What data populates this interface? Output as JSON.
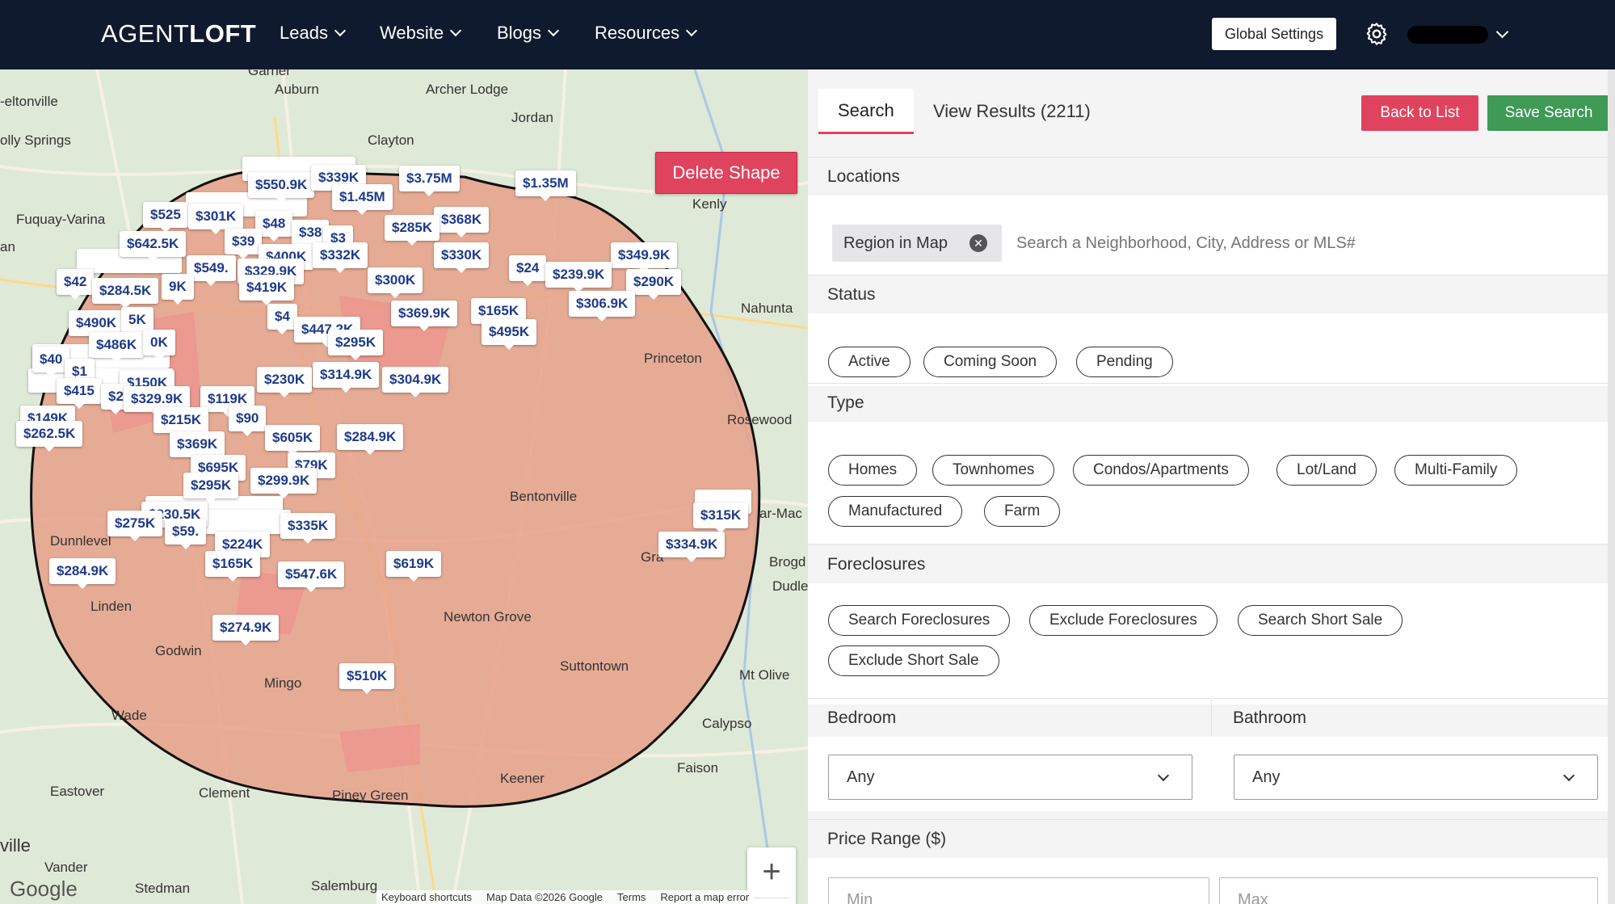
{
  "nav": {
    "logo_light": "AGENT",
    "logo_bold": "LOFT",
    "items": [
      {
        "label": "Leads"
      },
      {
        "label": "Website"
      },
      {
        "label": "Blogs"
      },
      {
        "label": "Resources"
      }
    ],
    "global_settings": "Global Settings",
    "icons": {
      "settings": "gear-icon",
      "user_menu": "chevron-down-icon"
    }
  },
  "map": {
    "delete_shape": "Delete Shape",
    "zoom_in": "+",
    "zoom_out": "−",
    "google": "Google",
    "footer": {
      "shortcuts": "Keyboard shortcuts",
      "map_data": "Map Data ©2026 Google",
      "terms": "Terms",
      "report": "Report a map error"
    },
    "places": [
      "Auburn",
      "Archer Lodge",
      "Jordan",
      "Clayton",
      "Fuquay-Varina",
      "Kenly",
      "Nahunta",
      "Princeton",
      "Rosewood",
      "Bentonville",
      "Dunnlevel",
      "Linden",
      "Godwin",
      "Mingo",
      "Newton Grove",
      "Suttontown",
      "Mt Olive",
      "Wade",
      "Calypso",
      "Faison",
      "Eastover",
      "Clement",
      "Piney Green",
      "Keener",
      "Vander",
      "Stedman",
      "Salemburg",
      "-eltonville",
      "olly Springs",
      "Brogd",
      "Dudle",
      "ville",
      "an",
      "Garner",
      "Gra",
      "ar-Mac"
    ],
    "pins": [
      "$550.9K",
      "$339K",
      "$3.75M",
      "$1.35M",
      "$1.45M",
      "$525",
      "$301K",
      "$48",
      "$368K",
      "$642.5K",
      "$39",
      "$38",
      "$3",
      "$285K",
      "$400K",
      "$332K",
      "$330K",
      "$349.9K",
      "$549.",
      "$329.9K",
      "$300K",
      "$24",
      "$239.9K",
      "$290K",
      "$42",
      "$284.5K",
      "9K",
      "$419K",
      "$306.9K",
      "$490K",
      "5K",
      "$4",
      "$447.2K",
      "$369.9K",
      "$165K",
      "$495K",
      "$486K",
      "0K",
      "$295K",
      "$40",
      "$1",
      "$314.9K",
      "$304.9K",
      "$230K",
      "$415",
      "$150K",
      "$2",
      "$329.9K",
      "$119K",
      "$149K",
      "$215K",
      "$90",
      "$262.5K",
      "$369K",
      "$605K",
      "$284.9K",
      "$695K",
      "$79K",
      "$299.9K",
      "$295K",
      "$315K",
      "$230.5K",
      "$275K",
      "$59.",
      "$335K",
      "$224K",
      "$334.9K",
      "$619K",
      "$165K",
      "$547.6K",
      "$284.9K",
      "$274.9K",
      "$510K"
    ]
  },
  "panel": {
    "tab_search": "Search",
    "tab_results": "View Results (2211)",
    "back_to_list": "Back to List",
    "save_search": "Save Search",
    "locations": {
      "heading": "Locations",
      "region_chip": "Region in Map",
      "search_placeholder": "Search a Neighborhood, City, Address or MLS#"
    },
    "status": {
      "heading": "Status",
      "options": [
        "Active",
        "Coming Soon",
        "Pending"
      ]
    },
    "type": {
      "heading": "Type",
      "options": [
        "Homes",
        "Townhomes",
        "Condos/Apartments",
        "Lot/Land",
        "Multi-Family",
        "Manufactured",
        "Farm"
      ]
    },
    "foreclosures": {
      "heading": "Foreclosures",
      "options": [
        "Search Foreclosures",
        "Exclude Foreclosures",
        "Search Short Sale",
        "Exclude Short Sale"
      ]
    },
    "bedroom": {
      "heading": "Bedroom",
      "value": "Any"
    },
    "bathroom": {
      "heading": "Bathroom",
      "value": "Any"
    },
    "price": {
      "heading": "Price Range ($)",
      "min_placeholder": "Min",
      "max_placeholder": "Max"
    }
  },
  "colors": {
    "nav_bg": "#0f1a2e",
    "accent_red": "#e0435e",
    "save_green": "#3e9a55",
    "pin_text": "#1e3a8a",
    "shape_fill": "#e8a08a"
  }
}
